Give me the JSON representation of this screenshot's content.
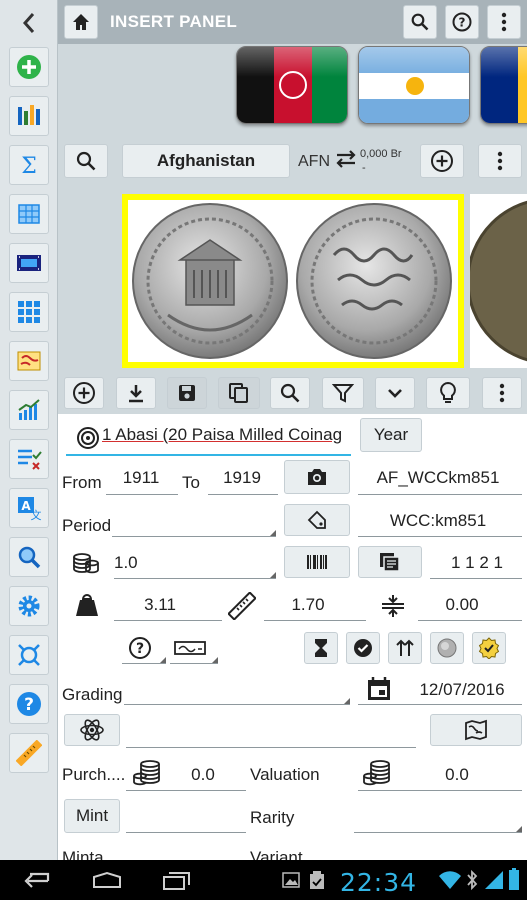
{
  "topbar": {
    "title": "INSERT PANEL",
    "back_icon": "chevron-left-icon",
    "home_icon": "home-icon",
    "search_icon": "search-icon",
    "help_icon": "help-icon",
    "more_icon": "more-vert-icon"
  },
  "sidebar": {
    "items": [
      {
        "icon": "add-icon"
      },
      {
        "icon": "columns-icon"
      },
      {
        "icon": "sum-icon"
      },
      {
        "icon": "table-icon"
      },
      {
        "icon": "film-icon"
      },
      {
        "icon": "grid-icon"
      },
      {
        "icon": "map-icon"
      },
      {
        "icon": "chart-icon"
      },
      {
        "icon": "checklist-icon"
      },
      {
        "icon": "translate-icon"
      },
      {
        "icon": "search-icon"
      },
      {
        "icon": "gear-icon"
      },
      {
        "icon": "orbit-icon"
      },
      {
        "icon": "help-icon"
      },
      {
        "icon": "ruler-icon"
      }
    ]
  },
  "flags": [
    "Afghanistan",
    "Argentina",
    "Barbados"
  ],
  "country": {
    "name": "Afghanistan",
    "currency_code": "AFN",
    "exchange_value": "0,000 Br",
    "exchange_dash": "-"
  },
  "coin_title": "1 Abasi (20 Paisa Milled Coinag",
  "year_button": "Year",
  "from_label": "From",
  "from_value": "1911",
  "to_label": "To",
  "to_value": "1919",
  "catalog_code": "AF_WCCkm851",
  "period_label": "Period",
  "catalog_ref": "WCC:km851",
  "value_field": "1.0",
  "quantity_field": "1 1 2 1",
  "weight_value": "3.11",
  "size_value": "1.70",
  "thickness_value": "0.00",
  "grading_label": "Grading",
  "date_value": "12/07/2016",
  "purchase_label": "Purch....",
  "purchase_value": "0.0",
  "valuation_label": "Valuation",
  "valuation_value": "0.0",
  "mint_button": "Mint",
  "rarity_label": "Rarity",
  "minta_label": "Minta...",
  "variant_label": "Variant",
  "status_bar": {
    "time": "22:34"
  },
  "colors": {
    "accent": "#33b5e5",
    "topbar": "#a8b3b9",
    "selection": "#ffff00"
  }
}
